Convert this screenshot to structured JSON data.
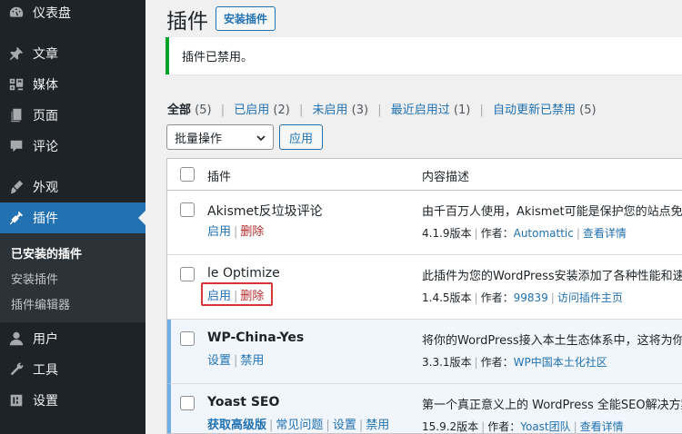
{
  "sidebar": {
    "dashboard": "仪表盘",
    "posts": "文章",
    "media": "媒体",
    "pages": "页面",
    "comments": "评论",
    "appearance": "外观",
    "plugins": "插件",
    "sub_installed": "已安装的插件",
    "sub_add_new": "安装插件",
    "sub_editor": "插件编辑器",
    "users": "用户",
    "tools": "工具",
    "settings": "设置"
  },
  "header": {
    "title": "插件",
    "add_new": "安装插件"
  },
  "notice": {
    "text": "插件已禁用。"
  },
  "views": {
    "all_label": "全部",
    "all_count": "(5)",
    "active_label": "已启用",
    "active_count": "(2)",
    "inactive_label": "未启用",
    "inactive_count": "(3)",
    "recent_label": "最近启用过",
    "recent_count": "(1)",
    "autoupdate_label": "自动更新已禁用",
    "autoupdate_count": "(5)"
  },
  "bulk": {
    "selected": "批量操作",
    "apply": "应用"
  },
  "table": {
    "col_plugin": "插件",
    "col_desc": "内容描述",
    "rows": [
      {
        "name": "Akismet反垃圾评论",
        "action_1": "启用",
        "action_2": "删除",
        "desc": "由千百万人使用，Akismet可能是保护您的站点免受",
        "version": "4.1.9版本",
        "author_label": "作者：",
        "author": "Automattic",
        "details": "查看详情",
        "active": false
      },
      {
        "name": "le Optimize",
        "action_1": "启用",
        "action_2": "删除",
        "desc": "此插件为您的WordPress安装添加了各种性能和速度",
        "version": "1.4.5版本",
        "author_label": "作者：",
        "author": "99839",
        "details": "访问插件主页",
        "active": false
      },
      {
        "name": "WP-China-Yes",
        "action_1": "设置",
        "action_2": "禁用",
        "desc": "将你的WordPress接入本土生态体系中，这将为你提",
        "version": "3.3.1版本",
        "author_label": "作者：",
        "author": "WP中国本土化社区",
        "active": true
      },
      {
        "name": "Yoast SEO",
        "action_1": "获取高级版",
        "action_2": "常见问题",
        "action_3": "设置",
        "action_4": "禁用",
        "desc": "第一个真正意义上的 WordPress 全能SEO解决方案",
        "version": "15.9.2版本",
        "author_label": "作者：",
        "author": "Yoast团队",
        "details": "查看详情",
        "active": true
      }
    ]
  },
  "colors": {
    "sidebar_bg": "#1d2327",
    "accent": "#2271b1",
    "delete": "#b32d2e",
    "notice_border": "#00a32a",
    "highlight": "#d63638"
  }
}
